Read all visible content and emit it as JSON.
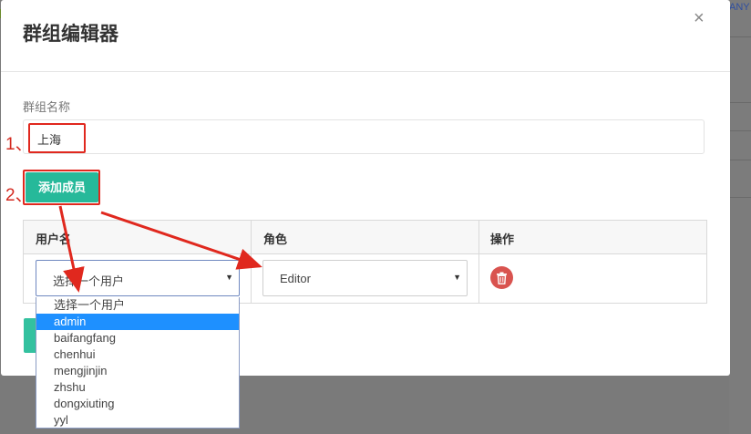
{
  "background": {
    "corner_text": "ANY"
  },
  "modal": {
    "title": "群组编辑器",
    "close": "×",
    "group_name_label": "群组名称",
    "group_name_value": "上海",
    "add_member_label": "添加成员"
  },
  "annotations": {
    "step1": "1、",
    "step2": "2、",
    "color": "#d42a20"
  },
  "table": {
    "headers": [
      "用户名",
      "角色",
      "操作"
    ],
    "row": {
      "user_select_value": "选择一个用户",
      "role_select_value": "Editor"
    }
  },
  "user_dropdown": {
    "options": [
      "选择一个用户",
      "admin",
      "baifangfang",
      "chenhui",
      "mengjinjin",
      "zhshu",
      "dongxiuting",
      "yyl"
    ],
    "highlighted_index": 1
  },
  "colors": {
    "accent": "#26b99a",
    "danger": "#d9534f",
    "highlight": "#1e90ff"
  }
}
